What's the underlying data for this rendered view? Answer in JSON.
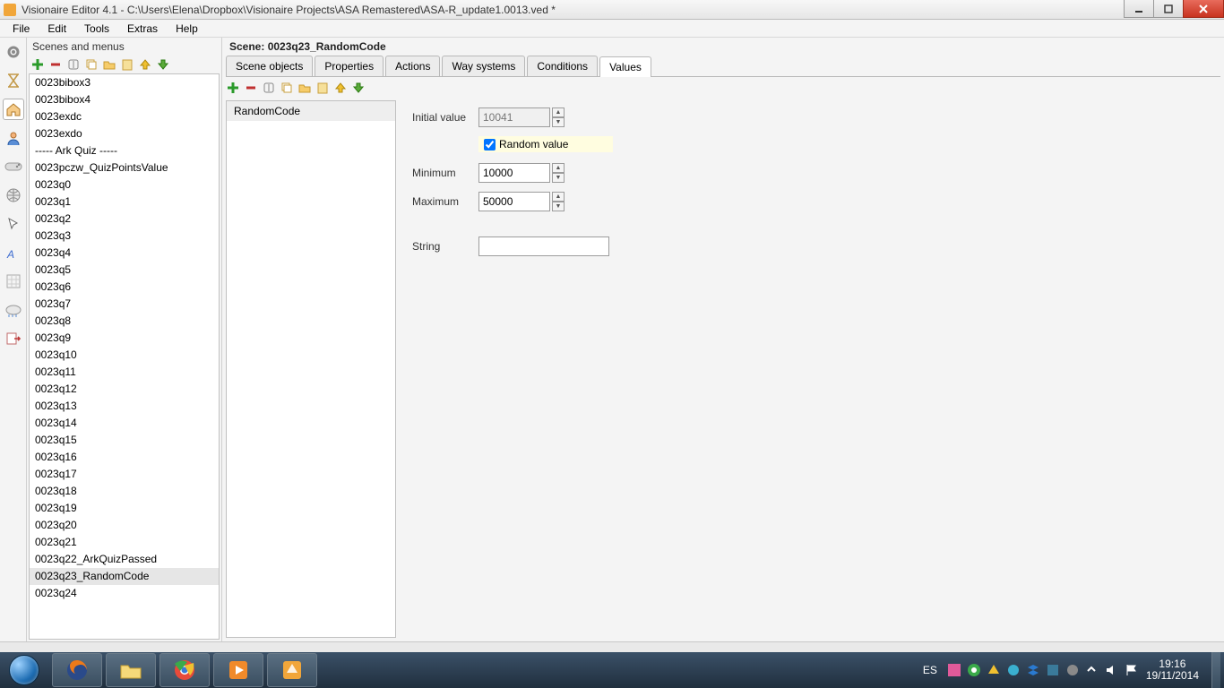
{
  "window": {
    "title": "Visionaire Editor 4.1 - C:\\Users\\Elena\\Dropbox\\Visionaire Projects\\ASA Remastered\\ASA-R_update1.0013.ved *"
  },
  "menu": {
    "items": [
      "File",
      "Edit",
      "Tools",
      "Extras",
      "Help"
    ]
  },
  "scenes_panel": {
    "title": "Scenes and menus",
    "items": [
      "0023bibox3",
      "0023bibox4",
      "0023exdc",
      "0023exdo",
      "----- Ark Quiz -----",
      "0023pczw_QuizPointsValue",
      "0023q0",
      "0023q1",
      "0023q2",
      "0023q3",
      "0023q4",
      "0023q5",
      "0023q6",
      "0023q7",
      "0023q8",
      "0023q9",
      "0023q10",
      "0023q11",
      "0023q12",
      "0023q13",
      "0023q14",
      "0023q15",
      "0023q16",
      "0023q17",
      "0023q18",
      "0023q19",
      "0023q20",
      "0023q21",
      "0023q22_ArkQuizPassed",
      "0023q23_RandomCode",
      "0023q24"
    ],
    "selected_index": 29
  },
  "scene": {
    "heading_prefix": "Scene: ",
    "name": "0023q23_RandomCode",
    "tabs": [
      "Scene objects",
      "Properties",
      "Actions",
      "Way systems",
      "Conditions",
      "Values"
    ],
    "active_tab": 5
  },
  "value_list": {
    "items": [
      "RandomCode"
    ],
    "selected_index": 0
  },
  "props": {
    "labels": {
      "initial": "Initial value",
      "random": "Random value",
      "min": "Minimum",
      "max": "Maximum",
      "string": "String"
    },
    "initial": "10041",
    "random_checked": true,
    "min": "10000",
    "max": "50000",
    "string": ""
  },
  "taskbar": {
    "lang": "ES",
    "time": "19:16",
    "date": "19/11/2014"
  }
}
